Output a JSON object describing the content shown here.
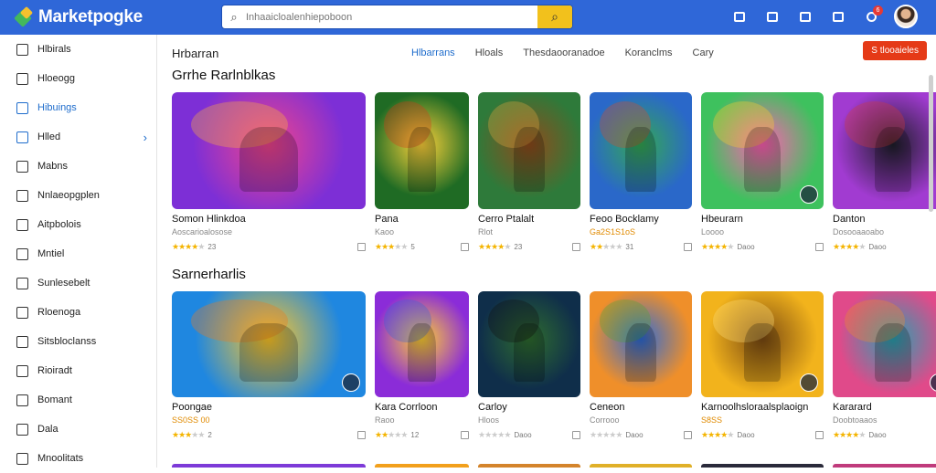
{
  "app": {
    "logo_text": "Marketpogke"
  },
  "search": {
    "placeholder": "Inhaaicloalenhiepoboon"
  },
  "topbar": {
    "badge_count": "6"
  },
  "sidebar": {
    "items": [
      {
        "label": "Hlbirals",
        "icon": "pencil-icon"
      },
      {
        "label": "Hloeogg",
        "icon": "document-icon"
      },
      {
        "label": "Hibuings",
        "icon": "document-icon",
        "active": true
      },
      {
        "label": "Hlled",
        "icon": "folder-icon",
        "chevron": "›"
      },
      {
        "label": "Mabns",
        "icon": "monitor-icon"
      },
      {
        "label": "Nnlaeopgplen",
        "icon": "tag-icon"
      },
      {
        "label": "Aitpbolois",
        "icon": "clipboard-icon"
      },
      {
        "label": "Mntiel",
        "icon": "edit-icon"
      },
      {
        "label": "Sunlesebelt",
        "icon": "pencil-icon"
      },
      {
        "label": "Rloenoga",
        "icon": "document-icon"
      },
      {
        "label": "Sitsbloclanss",
        "icon": "document-icon"
      },
      {
        "label": "Rioiradt",
        "icon": "card-icon"
      },
      {
        "label": "Bomant",
        "icon": "clipboard-icon"
      },
      {
        "label": "Dala",
        "icon": "list-icon"
      },
      {
        "label": "Mnoolitats",
        "icon": "pin-icon"
      }
    ]
  },
  "main": {
    "title": "Hrbarran",
    "tabs": [
      "Hlbarrans",
      "Hloals",
      "Thesdaooranadoe",
      "Koranclms",
      "Cary"
    ],
    "cta_label": "S  tlooaieles"
  },
  "sections": [
    {
      "title": "Grrhe Rarlnblkas",
      "cards": [
        {
          "title": "Somon Hlinkdoa",
          "subtitle": "Aoscarioalosose",
          "subtitle_type": "muted",
          "stars": 4,
          "meta": "23",
          "colors": [
            "#7d2fd6",
            "#f0448c",
            "#ffb13b"
          ],
          "overlay": false
        },
        {
          "title": "Pana",
          "subtitle": "Kaoo",
          "subtitle_type": "muted",
          "stars": 3,
          "meta": "5",
          "colors": [
            "#1f6b24",
            "#ffd23a",
            "#d43b1a"
          ],
          "overlay": false
        },
        {
          "title": "Cerro Ptalalt",
          "subtitle": "Rlot",
          "subtitle_type": "muted",
          "stars": 4,
          "meta": "23",
          "colors": [
            "#2e7a3a",
            "#8f4b1c",
            "#e0a640"
          ],
          "overlay": false
        },
        {
          "title": "Feoo Bocklamy",
          "subtitle": "Ga2S1S1oS",
          "subtitle_type": "price",
          "stars": 2,
          "meta": "31",
          "colors": [
            "#2a68c9",
            "#34a853",
            "#d44d2b"
          ],
          "overlay": false
        },
        {
          "title": "Hbeurarn",
          "subtitle": "Loooo",
          "subtitle_type": "muted",
          "stars": 4,
          "meta": "Daoo",
          "colors": [
            "#3ec15e",
            "#ff5fb3",
            "#ffcf2b"
          ],
          "overlay": true
        },
        {
          "title": "Danton",
          "subtitle": "Dosooaaoabo",
          "subtitle_type": "muted",
          "stars": 4,
          "meta": "Daoo",
          "colors": [
            "#a13bd1",
            "#1e1e2a",
            "#d23a3a"
          ],
          "overlay": false
        }
      ]
    },
    {
      "title": "Sarnerharlis",
      "cards": [
        {
          "title": "Poongae",
          "subtitle": "SS0SS 00",
          "subtitle_type": "price",
          "stars": 3,
          "meta": "2",
          "colors": [
            "#1f87e0",
            "#ffc727",
            "#ef7a1d"
          ],
          "overlay": true
        },
        {
          "title": "Kara Corrloon",
          "subtitle": "Raoo",
          "subtitle_type": "muted",
          "stars": 2,
          "meta": "12",
          "colors": [
            "#8b2cd8",
            "#ffcf33",
            "#3a64d8"
          ],
          "overlay": false
        },
        {
          "title": "Carloy",
          "subtitle": "Hloos",
          "subtitle_type": "muted",
          "stars": 0,
          "meta": "Daoo",
          "colors": [
            "#0f2e4a",
            "#2f6d2f",
            "#111"
          ],
          "overlay": false
        },
        {
          "title": "Ceneon",
          "subtitle": "Corrooo",
          "subtitle_type": "muted",
          "stars": 0,
          "meta": "Daoo",
          "colors": [
            "#ef8f2a",
            "#2e6bd6",
            "#4ea23a"
          ],
          "overlay": false
        },
        {
          "title": "Karnoolhsloraalsplaoign",
          "subtitle": "S8SS",
          "subtitle_type": "price",
          "stars": 4,
          "meta": "Daoo",
          "colors": [
            "#f2b31c",
            "#7b4a12",
            "#ffe07a"
          ],
          "overlay": true
        },
        {
          "title": "Kararard",
          "subtitle": "Doobtoaaos",
          "subtitle_type": "muted",
          "stars": 4,
          "meta": "Daoo",
          "colors": [
            "#e04a8a",
            "#2aa0b0",
            "#f08a2b"
          ],
          "overlay": true
        }
      ]
    }
  ],
  "peek_colors": [
    "#7d3ad8",
    "#f2a01c",
    "#d4842b",
    "#e0b028",
    "#2a2a3a",
    "#c03b7c"
  ]
}
